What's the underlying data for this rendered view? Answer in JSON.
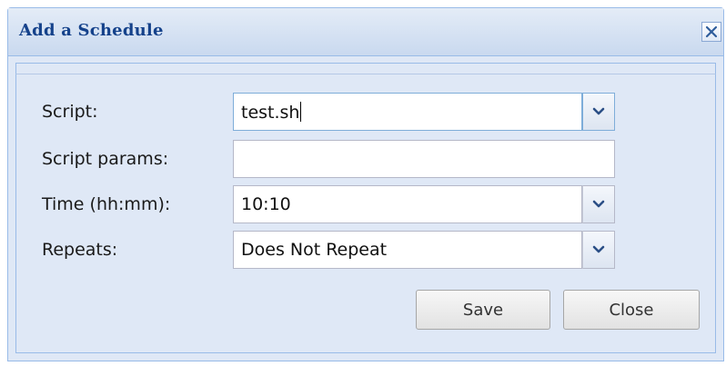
{
  "dialog": {
    "title": "Add a Schedule"
  },
  "form": {
    "script": {
      "label": "Script:",
      "value": "test.sh"
    },
    "script_params": {
      "label": "Script params:",
      "value": ""
    },
    "time": {
      "label": "Time (hh:mm):",
      "value": "10:10"
    },
    "repeats": {
      "label": "Repeats:",
      "value": "Does Not Repeat"
    }
  },
  "buttons": {
    "save": "Save",
    "close": "Close"
  },
  "icons": {
    "close": "close-icon",
    "dropdown": "chevron-down-icon"
  },
  "colors": {
    "title": "#15428b",
    "panel_bg": "#dfe8f6",
    "border": "#99bbe8"
  }
}
